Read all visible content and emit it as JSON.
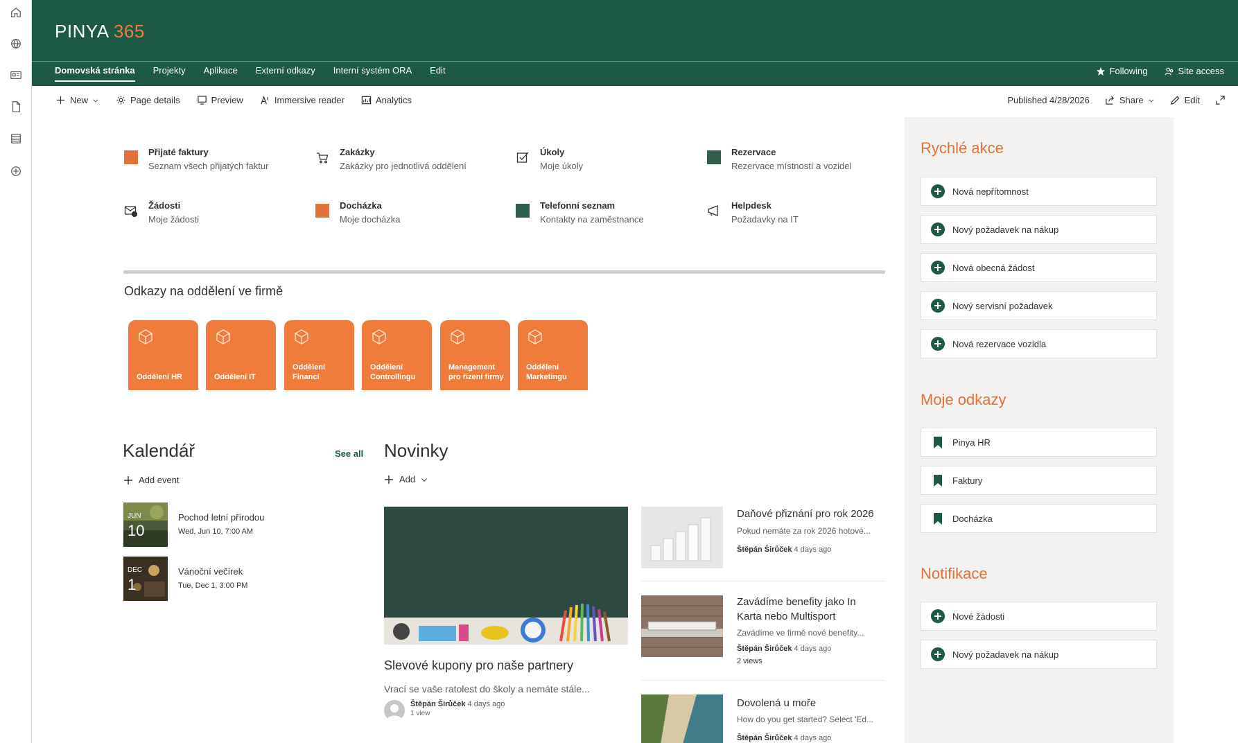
{
  "header": {
    "brand_name": "PINYA",
    "brand_number": "365",
    "nav": [
      "Domovská stránka",
      "Projekty",
      "Aplikace",
      "Externí odkazy",
      "Interní systém ORA",
      "Edit"
    ],
    "following_label": "Following",
    "site_access_label": "Site access"
  },
  "commandbar": {
    "new_label": "New",
    "page_details_label": "Page details",
    "preview_label": "Preview",
    "immersive_reader_label": "Immersive reader",
    "analytics_label": "Analytics",
    "published_label": "Published 4/28/2026",
    "share_label": "Share",
    "edit_label": "Edit"
  },
  "quicklinks": [
    {
      "title": "Přijaté faktury",
      "subtitle": "Seznam všech přijatých faktur",
      "icon": "orange-square-icon"
    },
    {
      "title": "Zakázky",
      "subtitle": "Zakázky pro jednotlivá oddělení",
      "icon": "cart-icon"
    },
    {
      "title": "Úkoly",
      "subtitle": "Moje úkoly",
      "icon": "checkbox-icon"
    },
    {
      "title": "Rezervace",
      "subtitle": "Rezervace místností a vozidel",
      "icon": "green-square-icon"
    },
    {
      "title": "Žádosti",
      "subtitle": "Moje žádosti",
      "icon": "mail-icon"
    },
    {
      "title": "Docházka",
      "subtitle": "Moje docházka",
      "icon": "orange-square-icon"
    },
    {
      "title": "Telefonní seznam",
      "subtitle": "Kontakty na zaměstnance",
      "icon": "green-square-icon"
    },
    {
      "title": "Helpdesk",
      "subtitle": "Požadavky na IT",
      "icon": "megaphone-icon"
    }
  ],
  "departments": {
    "heading": "Odkazy na oddělení ve firmě",
    "tiles": [
      "Oddělení HR",
      "Oddělení IT",
      "Oddělení Financí",
      "Oddělení Controllingu",
      "Management pro řízení firmy",
      "Oddělení Marketingu"
    ]
  },
  "calendar": {
    "heading": "Kalendář",
    "see_all": "See all",
    "add_event": "Add event",
    "events": [
      {
        "month": "JUN",
        "day": "10",
        "title": "Pochod letní přírodou",
        "date": "Wed, Jun 10, 7:00 AM"
      },
      {
        "month": "DEC",
        "day": "1",
        "title": "Vánoční večírek",
        "date": "Tue, Dec 1, 3:00 PM"
      }
    ]
  },
  "news": {
    "heading": "Novinky",
    "add_label": "Add",
    "main": {
      "title": "Slevové kupony pro naše partnery",
      "description": "Vrací se vaše ratolest do školy a nemáte stále...",
      "author": "Štěpán Širůček",
      "time": "4 days ago",
      "views": "1 view"
    },
    "items": [
      {
        "title": "Daňové přiznání pro rok 2026",
        "description": "Pokud nemáte za rok 2026 hotové...",
        "author": "Štěpán Širůček",
        "time": "4 days ago",
        "views": ""
      },
      {
        "title": "Zavádíme benefity jako In Karta nebo Multisport",
        "description": "Zavádíme ve firmě nové benefity...",
        "author": "Štěpán Širůček",
        "time": "4 days ago",
        "views": "2 views"
      },
      {
        "title": "Dovolená u moře",
        "description": "How do you get started? Select 'Ed...",
        "author": "Štěpán Širůček",
        "time": "4 days ago",
        "views": ""
      }
    ]
  },
  "rightpanel": {
    "quick_actions_title": "Rychlé akce",
    "quick_actions": [
      "Nová nepřítomnost",
      "Nový požadavek na nákup",
      "Nová obecná žádost",
      "Nový servisní požadavek",
      "Nová rezervace vozidla"
    ],
    "my_links_title": "Moje odkazy",
    "my_links": [
      "Pinya HR",
      "Faktury",
      "Docházka"
    ],
    "notifications_title": "Notifikace",
    "notifications": [
      "Nové žádosti",
      "Nový požadavek na nákup"
    ]
  },
  "colors": {
    "brand_green": "#1c5a45",
    "accent_orange": "#f07c3c"
  }
}
